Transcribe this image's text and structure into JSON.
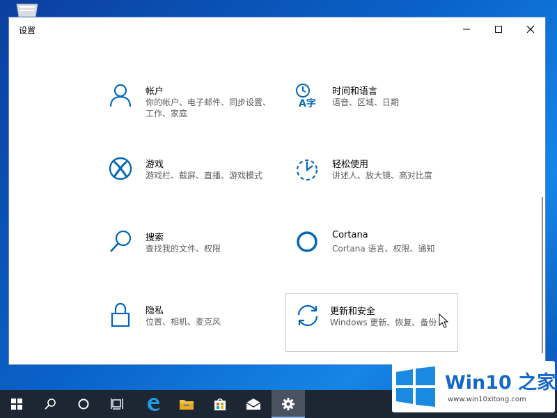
{
  "window": {
    "title": "设置"
  },
  "tiles": [
    {
      "name": "帐户",
      "desc": "你的帐户、电子邮件、同步设置、工作、家庭",
      "icon": "user-icon"
    },
    {
      "name": "时间和语言",
      "desc": "语音、区域、日期",
      "icon": "time-language-icon"
    },
    {
      "name": "游戏",
      "desc": "游戏栏、截屏、直播、游戏模式",
      "icon": "xbox-icon"
    },
    {
      "name": "轻松使用",
      "desc": "讲述人、放大镜、高对比度",
      "icon": "ease-of-access-icon"
    },
    {
      "name": "搜索",
      "desc": "查找我的文件、权限",
      "icon": "search-icon"
    },
    {
      "name": "Cortana",
      "desc": "Cortana 语言、权限、通知",
      "icon": "cortana-icon"
    },
    {
      "name": "隐私",
      "desc": "位置、相机、麦克风",
      "icon": "lock-icon"
    },
    {
      "name": "更新和安全",
      "desc": "Windows 更新、恢复、备份",
      "icon": "update-icon"
    }
  ],
  "taskbar": [
    "start-icon",
    "search-icon",
    "cortana-icon",
    "task-view-icon",
    "edge-icon",
    "file-explorer-icon",
    "store-icon",
    "mail-icon",
    "settings-icon"
  ],
  "watermark": {
    "name": "Win10 之家",
    "url": "www.win10xitong.com"
  },
  "colors": {
    "accent": "#0067b8",
    "taskbar": "#1d2633",
    "active_task": "#4a5260"
  }
}
